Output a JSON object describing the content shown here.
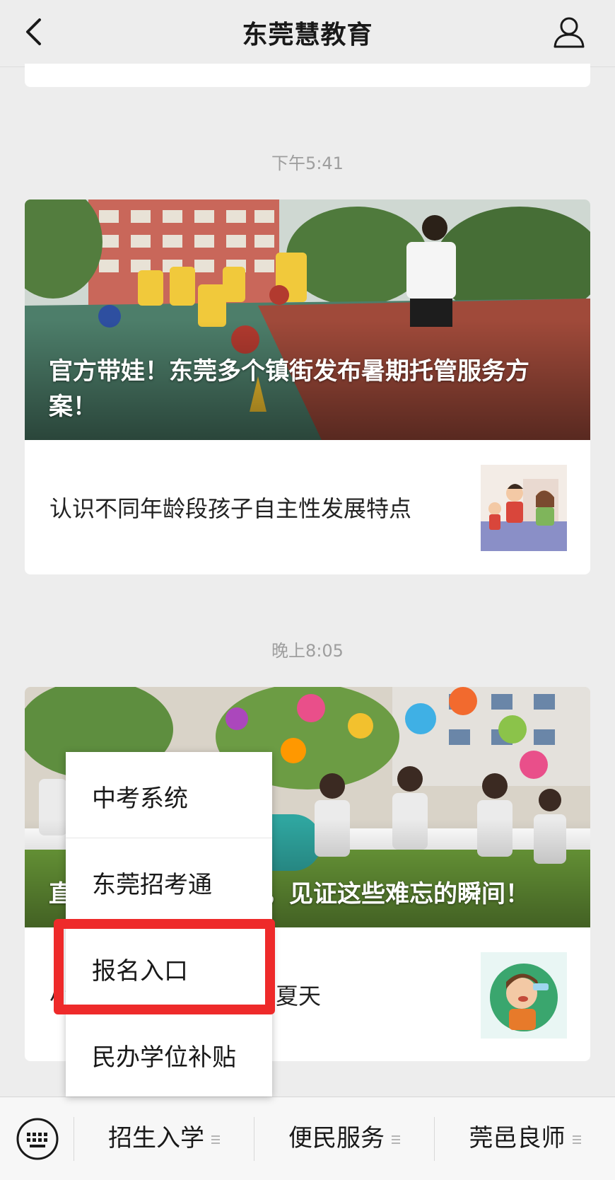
{
  "header": {
    "title": "东莞慧教育",
    "back_icon": "chevron-left-icon",
    "profile_icon": "person-icon"
  },
  "messages": [
    {
      "time": "下午5:41",
      "headline": "官方带娃！东莞多个镇街发布暑期托管服务方案！",
      "sub_title": "认识不同年龄段孩子自主性发展特点"
    },
    {
      "time": "晚上8:05",
      "headline": "直击东莞幼儿毕业礼，见证这些难忘的瞬间！",
      "sub_title": "小心中暑！预防中暑一夏天"
    }
  ],
  "popup": {
    "items": [
      "中考系统",
      "东莞招考通",
      "报名入口",
      "民办学位补贴"
    ],
    "highlighted_index": 2
  },
  "bottom_bar": {
    "keyboard_icon": "keyboard-icon",
    "tabs": [
      "招生入学",
      "便民服务",
      "莞邑良师"
    ]
  },
  "colors": {
    "background": "#ededed",
    "highlight": "#ee2a2a"
  }
}
